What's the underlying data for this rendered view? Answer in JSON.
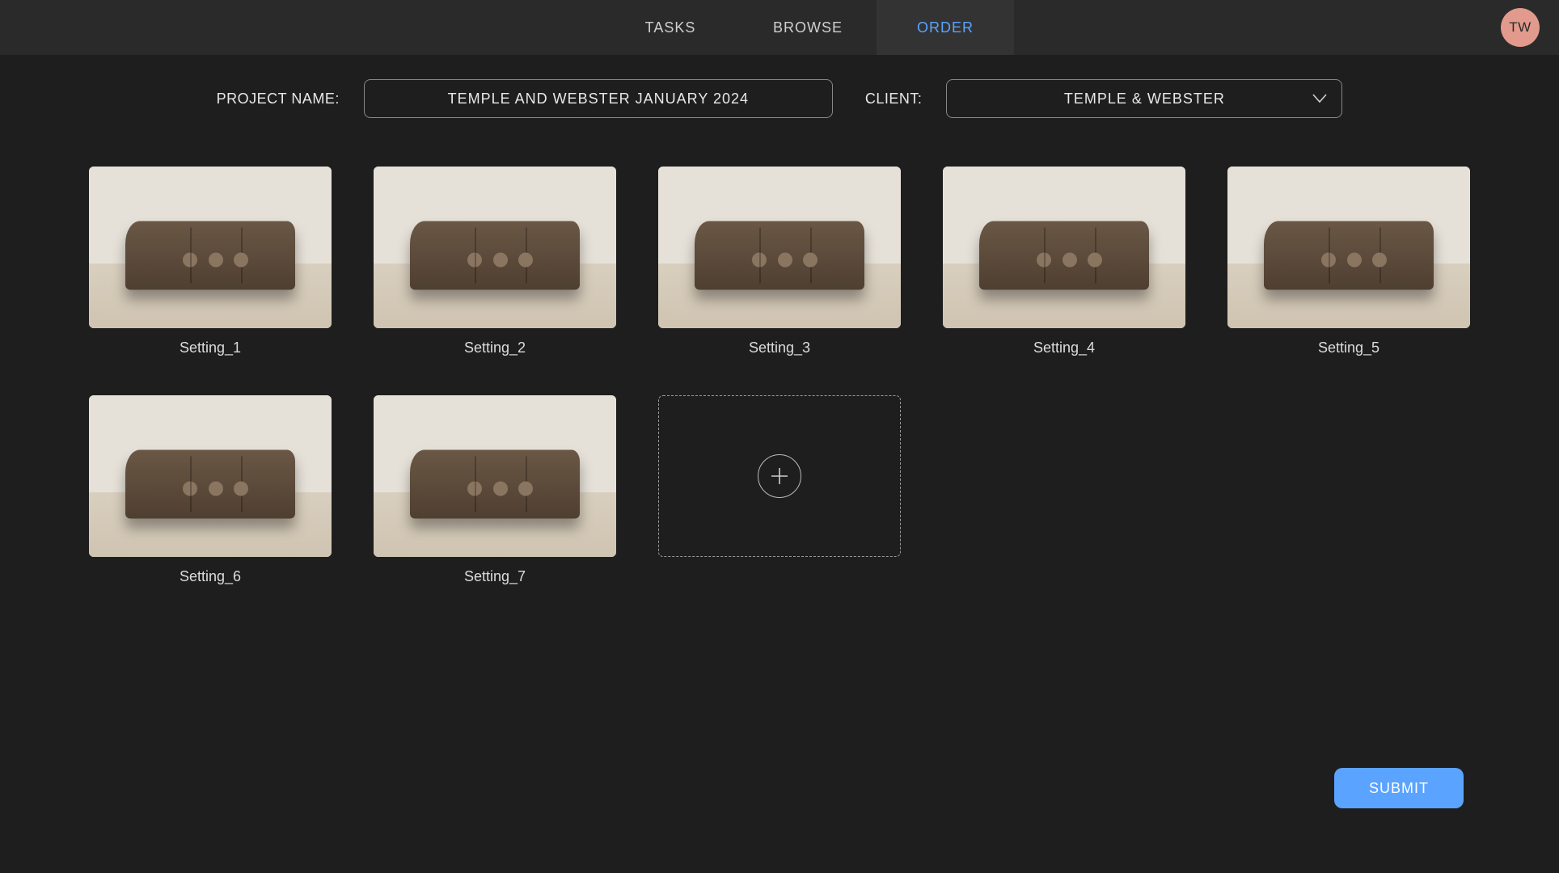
{
  "nav": {
    "tabs": [
      {
        "label": "TASKS",
        "active": false
      },
      {
        "label": "BROWSE",
        "active": false
      },
      {
        "label": "ORDER",
        "active": true
      }
    ]
  },
  "avatar": {
    "initials": "TW"
  },
  "form": {
    "project_label": "PROJECT NAME:",
    "project_value": "TEMPLE AND WEBSTER JANUARY 2024",
    "client_label": "CLIENT:",
    "client_value": "TEMPLE & WEBSTER"
  },
  "settings": [
    {
      "label": "Setting_1"
    },
    {
      "label": "Setting_2"
    },
    {
      "label": "Setting_3"
    },
    {
      "label": "Setting_4"
    },
    {
      "label": "Setting_5"
    },
    {
      "label": "Setting_6"
    },
    {
      "label": "Setting_7"
    }
  ],
  "actions": {
    "submit_label": "SUBMIT"
  },
  "colors": {
    "accent": "#5aa3ff",
    "avatar_bg": "#e29a8c"
  }
}
